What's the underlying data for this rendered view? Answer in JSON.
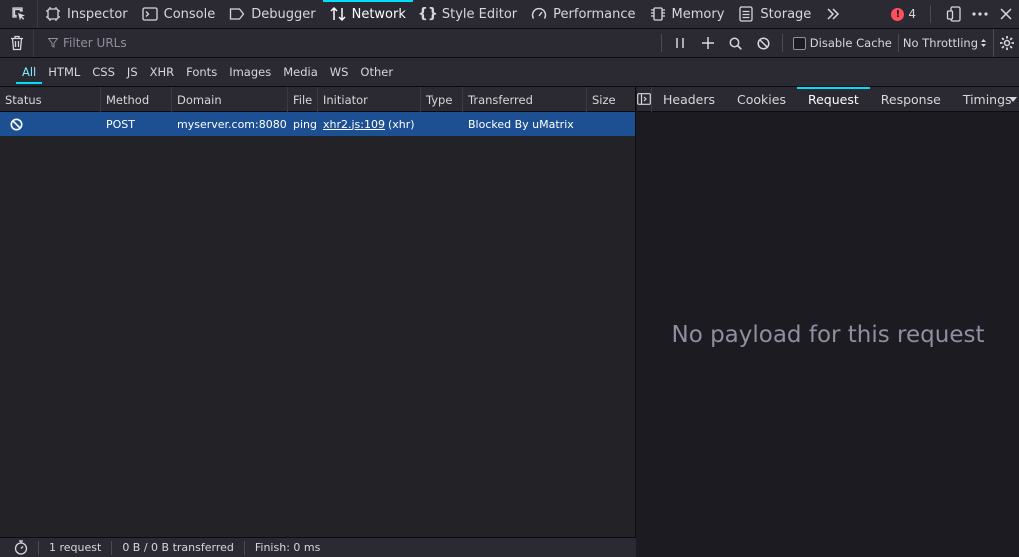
{
  "toolbox": {
    "tabs": [
      {
        "label": "Inspector",
        "icon": "inspector-icon"
      },
      {
        "label": "Console",
        "icon": "console-icon"
      },
      {
        "label": "Debugger",
        "icon": "debugger-icon"
      },
      {
        "label": "Network",
        "icon": "network-icon",
        "selected": true
      },
      {
        "label": "Style Editor",
        "icon": "style-editor-icon"
      },
      {
        "label": "Performance",
        "icon": "performance-icon"
      },
      {
        "label": "Memory",
        "icon": "memory-icon"
      },
      {
        "label": "Storage",
        "icon": "storage-icon"
      }
    ],
    "error_count": "4"
  },
  "network_toolbar": {
    "filter_placeholder": "Filter URLs",
    "disable_cache_label": "Disable Cache",
    "throttling_label": "No Throttling"
  },
  "type_filters": [
    "All",
    "HTML",
    "CSS",
    "JS",
    "XHR",
    "Fonts",
    "Images",
    "Media",
    "WS",
    "Other"
  ],
  "requests": {
    "columns": [
      "Status",
      "Method",
      "Domain",
      "File",
      "Initiator",
      "Type",
      "Transferred",
      "Size"
    ],
    "rows": [
      {
        "status_icon": "blocked-icon",
        "method": "POST",
        "domain": "myserver.com:8080",
        "file": "ping",
        "initiator_link": "xhr2.js:109",
        "initiator_suffix": "(xhr)",
        "type": "",
        "transferred": "Blocked By uMatrix",
        "size": ""
      }
    ]
  },
  "status_bar": {
    "requests": "1 request",
    "transferred": "0 B / 0 B transferred",
    "finish": "Finish: 0 ms"
  },
  "details": {
    "tabs": [
      "Headers",
      "Cookies",
      "Request",
      "Response",
      "Timings"
    ],
    "selected_tab": "Request",
    "empty_message": "No payload for this request"
  },
  "colors": {
    "accent": "#00ddff",
    "selected_row": "#1d4f93",
    "error_badge": "#ff4f5e"
  }
}
